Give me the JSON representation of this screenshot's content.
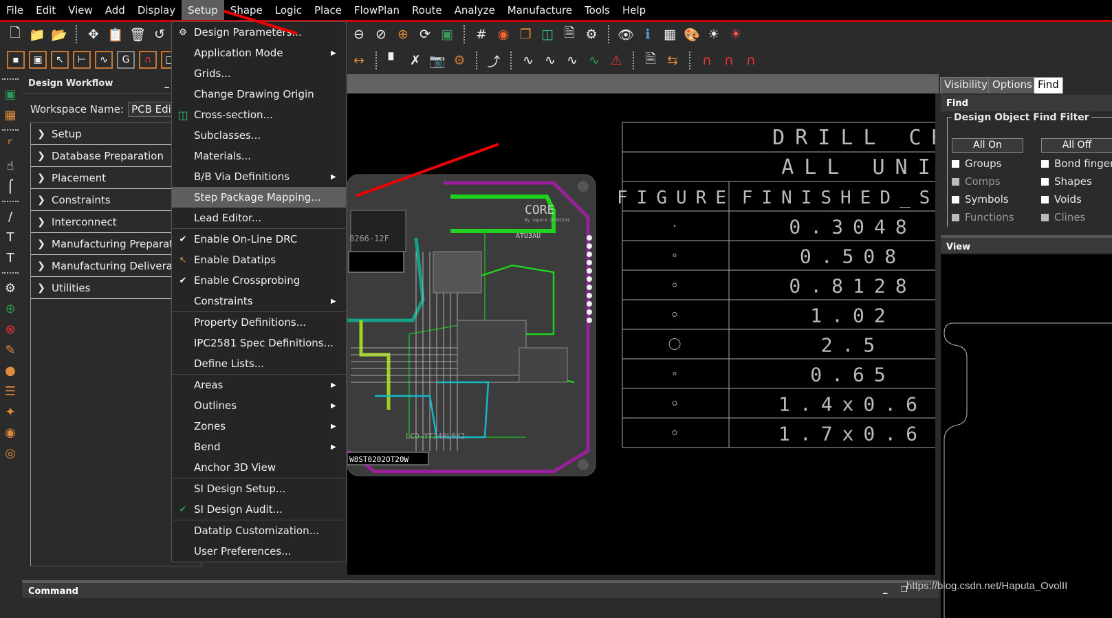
{
  "menubar": {
    "items": [
      "File",
      "Edit",
      "View",
      "Add",
      "Display",
      "Setup",
      "Shape",
      "Logic",
      "Place",
      "FlowPlan",
      "Route",
      "Analyze",
      "Manufacture",
      "Tools",
      "Help"
    ],
    "active": "Setup"
  },
  "toolbar_row1": {
    "icons": [
      "new-design-icon",
      "open-folder-icon",
      "save-icon",
      "move-icon",
      "copy-icon",
      "delete-icon",
      "undo-icon",
      "zoom-fit-icon",
      "zoom-out-icon",
      "zoom-previous-icon",
      "zoom-center-icon",
      "redraw-icon",
      "3d-board-icon",
      "grid-toggle-icon",
      "color-icon",
      "shadow-toggle-icon",
      "cross-section-icon",
      "report-icon",
      "parameters-icon",
      "visibility-icon",
      "properties-icon",
      "measure-icon",
      "palette-icon",
      "brightness-icon",
      "brightness-off-icon"
    ]
  },
  "toolbar_row2": {
    "icons": [
      "app-mode-icon",
      "placement-icon",
      "select-icon",
      "connect-icon",
      "route-icon",
      "general-edit-icon",
      "flow-icon",
      "shape-icon"
    ]
  },
  "left_toolbar": {
    "icons": [
      "place-manual-icon",
      "place-select-icon",
      "route-connect-icon",
      "slide-icon",
      "delay-tune-icon",
      "add-line-icon",
      "add-text-icon",
      "edit-text-icon",
      "constraint-settings-icon",
      "constraint-add-icon",
      "constraint-delete-icon",
      "constraint-edit-icon",
      "constraint-share-icon",
      "constraint-list-icon",
      "constraint-tool-icon",
      "constraint-toggle-icon",
      "constraint-view-icon"
    ]
  },
  "workflow": {
    "title": "Design Workflow",
    "minimize": "_",
    "workspace_label": "Workspace Name:",
    "workspace_value": "PCB Editor",
    "items": [
      "Setup",
      "Database Preparation",
      "Placement",
      "Constraints",
      "Interconnect",
      "Manufacturing Preparation",
      "Manufacturing Deliverables",
      "Utilities"
    ]
  },
  "setup_menu": {
    "items": [
      {
        "label": "Design Parameters...",
        "icon": "gear-doc-icon"
      },
      {
        "label": "Application Mode",
        "submenu": true
      },
      {
        "label": "Grids..."
      },
      {
        "label": "Change Drawing Origin"
      },
      {
        "label": "Cross-section...",
        "icon": "cross-section-icon"
      },
      {
        "label": "Subclasses..."
      },
      {
        "label": "Materials..."
      },
      {
        "label": "B/B Via Definitions",
        "submenu": true
      },
      {
        "label": "Step Package Mapping...",
        "highlighted": true
      },
      {
        "label": "Lead Editor...",
        "sep_after": true
      },
      {
        "label": "Enable On-Line DRC",
        "checked": true
      },
      {
        "label": "Enable Datatips",
        "icon": "datatip-icon"
      },
      {
        "label": "Enable Crossprobing",
        "checked": true
      },
      {
        "label": "Constraints",
        "submenu": true,
        "sep_after": true
      },
      {
        "label": "Property Definitions..."
      },
      {
        "label": "IPC2581 Spec Definitions..."
      },
      {
        "label": "Define Lists...",
        "sep_after": true
      },
      {
        "label": "Areas",
        "submenu": true
      },
      {
        "label": "Outlines",
        "submenu": true
      },
      {
        "label": "Zones",
        "submenu": true
      },
      {
        "label": "Bend",
        "submenu": true
      },
      {
        "label": "Anchor 3D View",
        "sep_after": true
      },
      {
        "label": "SI Design Setup..."
      },
      {
        "label": "SI Design Audit...",
        "icon": "si-audit-icon",
        "sep_after": true
      },
      {
        "label": "Datatip Customization..."
      },
      {
        "label": "User Preferences..."
      }
    ]
  },
  "drill_chart": {
    "title": "DRILL CHART",
    "units": "ALL UNITS",
    "col_figure": "FIGURE",
    "col_size": "FINISHED_SIZE",
    "rows": [
      "0.3048",
      "0.508",
      "0.8128",
      "1.02",
      "2.5",
      "0.65",
      "1.4x0.6",
      "1.7x0.6"
    ]
  },
  "board": {
    "label": "CORE",
    "sublabel": "By impura 20201224",
    "part_label": "ATU3AU",
    "lcd_label": "LCD-YT240L0X2",
    "module": "8266-12F",
    "bottom_text": "W8ST0202OT20W"
  },
  "right_panel": {
    "tabs": [
      "Visibility",
      "Options",
      "Find"
    ],
    "active_tab": "Find",
    "find_header": "Find",
    "filter_title": "Design Object Find Filter",
    "all_on": "All On",
    "all_off": "All Off",
    "left_checks": [
      {
        "label": "Groups",
        "enabled": true
      },
      {
        "label": "Comps",
        "enabled": false
      },
      {
        "label": "Symbols",
        "enabled": true
      },
      {
        "label": "Functions",
        "enabled": false
      }
    ],
    "right_checks": [
      {
        "label": "Bond fingers",
        "enabled": true
      },
      {
        "label": "Shapes",
        "enabled": true
      },
      {
        "label": "Voids",
        "enabled": true
      },
      {
        "label": "Clines",
        "enabled": false
      }
    ],
    "view_header": "View"
  },
  "command": {
    "label": "Command",
    "minimize": "_",
    "restore": "❐",
    "close": "✕"
  },
  "watermark": "https://blog.csdn.net/Haputa_OvolII"
}
